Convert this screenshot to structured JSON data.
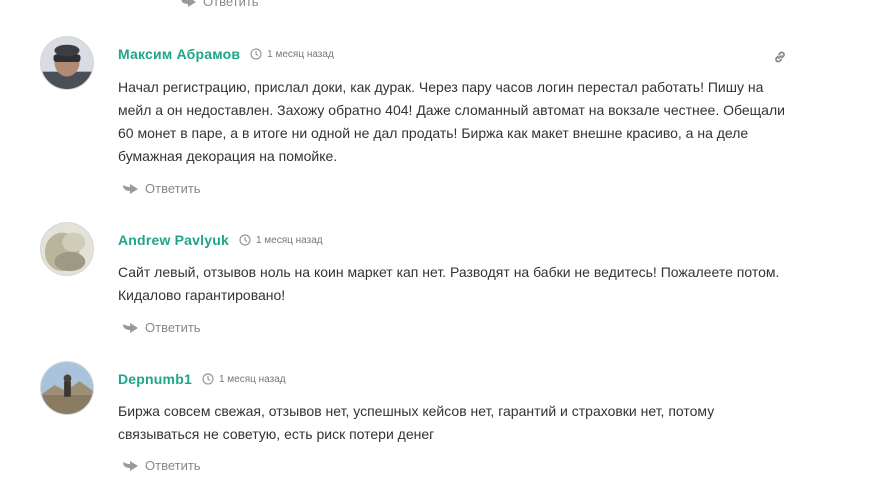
{
  "top_reply": {
    "label": "Ответить"
  },
  "comments": [
    {
      "author": "Максим Абрамов",
      "date": "1 месяц назад",
      "text_lines": [
        "Начал регистрацию, прислал доки, как дурак. Через пару часов логин перестал работать! Пишу на",
        "мейл а он недоставлен. Захожу обратно 404! Даже сломанный автомат на вокзале честнее. Обещали",
        "60 монет в паре, а в итоге ни одной не дал продать! Биржа как макет внешне красиво, а на деле",
        "бумажная декорация на помойке."
      ],
      "reply_label": "Ответить"
    },
    {
      "author": "Andrew Pavlyuk",
      "date": "1 месяц назад",
      "text_lines": [
        "Сайт левый, отзывов ноль на коин маркет кап нет. Разводят на бабки не ведитесь! Пожалеете потом.",
        "Кидалово гарантировано!"
      ],
      "reply_label": "Ответить"
    },
    {
      "author": "Depnumb1",
      "date": "1 месяц назад",
      "text_lines": [
        "Биржа совсем свежая, отзывов нет, успешных кейсов нет, гарантий и страховки нет, потому",
        "связываться не советую, есть риск потери денег"
      ],
      "reply_label": "Ответить"
    }
  ],
  "colors": {
    "author": "#1fa58a",
    "text": "#333333",
    "muted": "#888888"
  },
  "icons": [
    "reply-arrow-icon",
    "clock-icon",
    "link-icon"
  ]
}
